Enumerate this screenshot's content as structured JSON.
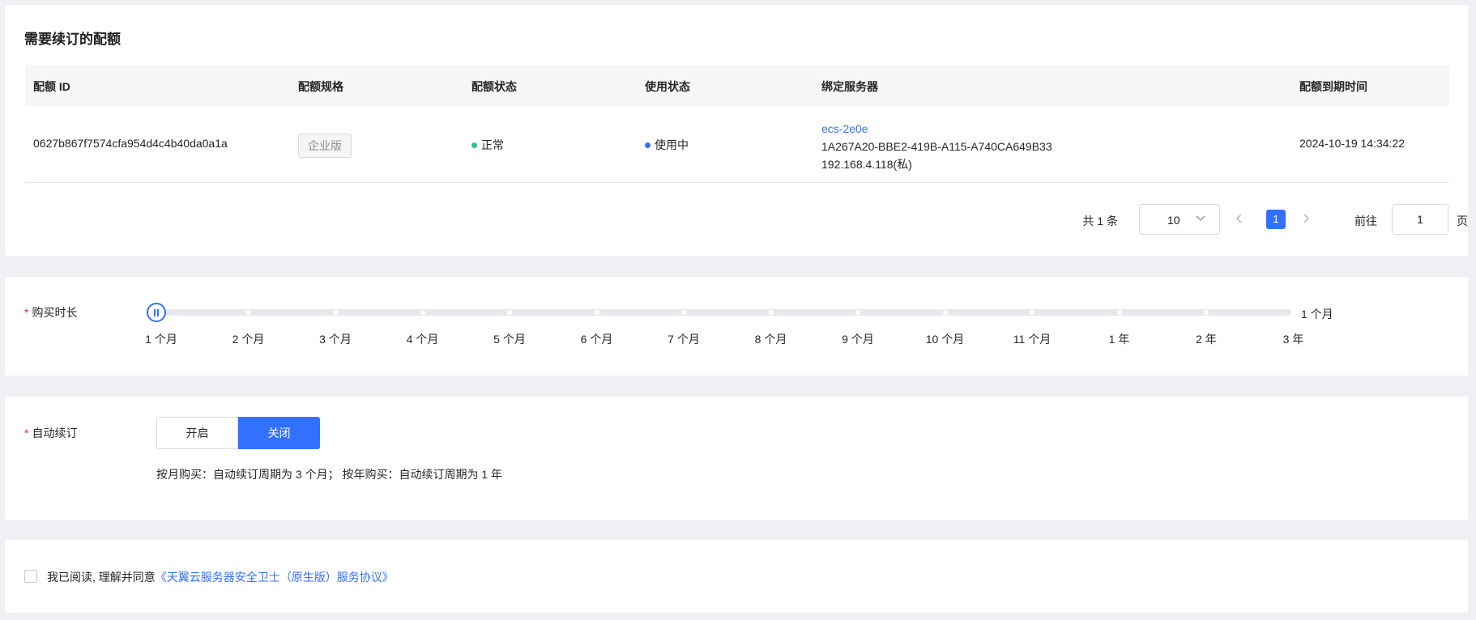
{
  "quota_section": {
    "title": "需要续订的配额",
    "columns": [
      "配额 ID",
      "配额规格",
      "配额状态",
      "使用状态",
      "绑定服务器",
      "配额到期时间"
    ],
    "rows": [
      {
        "quota_id": "0627b867f7574cfa954d4c4b40da0a1a",
        "spec": "企业版",
        "status": "正常",
        "usage": "使用中",
        "server_name": "ecs-2e0e",
        "server_uuid": "1A267A20-BBE2-419B-A115-A740CA649B33",
        "server_ip": "192.168.4.118(私)",
        "expire_time": "2024-10-19 14:34:22"
      }
    ],
    "status_color": "#20c788",
    "usage_color": "#3370ff"
  },
  "pagination": {
    "total": "共 1 条",
    "page_size": "10",
    "current_page": "1",
    "goto_label": "前往",
    "goto_value": "1",
    "page_unit": "页",
    "prev_icon": "chevron-left-icon",
    "next_icon": "chevron-right-icon",
    "select_icon": "chevron-down-icon"
  },
  "duration": {
    "label": "购买时长",
    "required_mark": "*",
    "options": [
      "1 个月",
      "2 个月",
      "3 个月",
      "4 个月",
      "5 个月",
      "6 个月",
      "7 个月",
      "8 个月",
      "9 个月",
      "10 个月",
      "11 个月",
      "1 年",
      "2 年",
      "3 年"
    ],
    "selected_index": 0,
    "selected_value": "1 个月"
  },
  "auto_renew": {
    "label": "自动续订",
    "required_mark": "*",
    "on_label": "开启",
    "off_label": "关闭",
    "selected": "关闭",
    "hint": "按月购买：自动续订周期为 3 个月； 按年购买：自动续订周期为 1 年"
  },
  "agreement": {
    "text": "我已阅读, 理解并同意",
    "link": "《天翼云服务器安全卫士（原生版）服务协议》",
    "checked": false
  },
  "colors": {
    "accent": "#3370ff",
    "background": "#eff0f4"
  }
}
